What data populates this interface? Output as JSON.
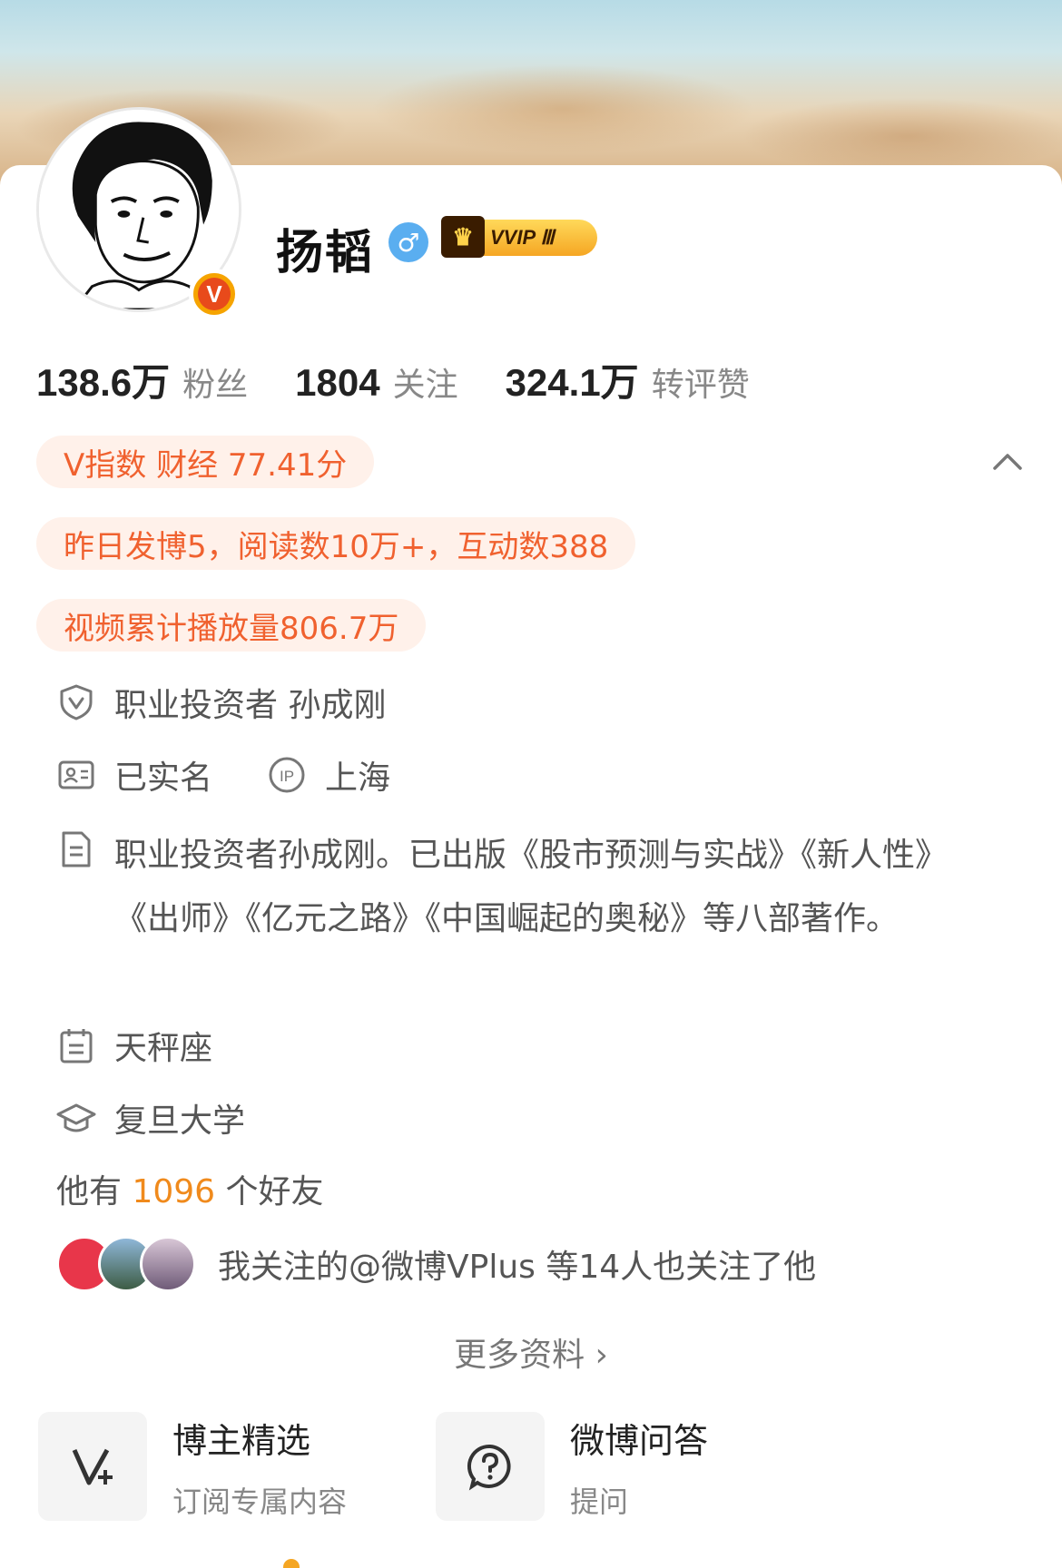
{
  "profile": {
    "name": "扬韬",
    "gender_symbol": "♂",
    "vvip_label": "VVIP Ⅲ",
    "verified_mark": "V"
  },
  "stats": [
    {
      "value": "138.6万",
      "label": "粉丝"
    },
    {
      "value": "1804",
      "label": "关注"
    },
    {
      "value": "324.1万",
      "label": "转评赞"
    }
  ],
  "pills": {
    "v_index": "V指数 财经 77.41分",
    "yesterday": "昨日发博5，阅读数10万+，互动数388",
    "video": "视频累计播放量806.7万"
  },
  "info": {
    "verification": "职业投资者 孙成刚",
    "realname": "已实名",
    "ip_location": "上海",
    "bio": "职业投资者孙成刚。已出版《股市预测与实战》《新人性》《出师》《亿元之路》《中国崛起的奥秘》等八部著作。",
    "constellation": "天秤座",
    "school": "复旦大学"
  },
  "friends": {
    "prefix": "他有",
    "count": "1096",
    "suffix": "个好友"
  },
  "mutual": {
    "text": "我关注的@微博VPlus 等14人也关注了他"
  },
  "more_info": "更多资料 ›",
  "features": [
    {
      "title": "博主精选",
      "subtitle": "订阅专属内容",
      "icon": "vplus-icon"
    },
    {
      "title": "微博问答",
      "subtitle": "提问",
      "icon": "question-icon"
    }
  ],
  "colors": {
    "accent": "#f0612f",
    "pill_bg": "#fff1ea",
    "friend_count": "#f08a1c",
    "gender": "#5aaef0"
  }
}
